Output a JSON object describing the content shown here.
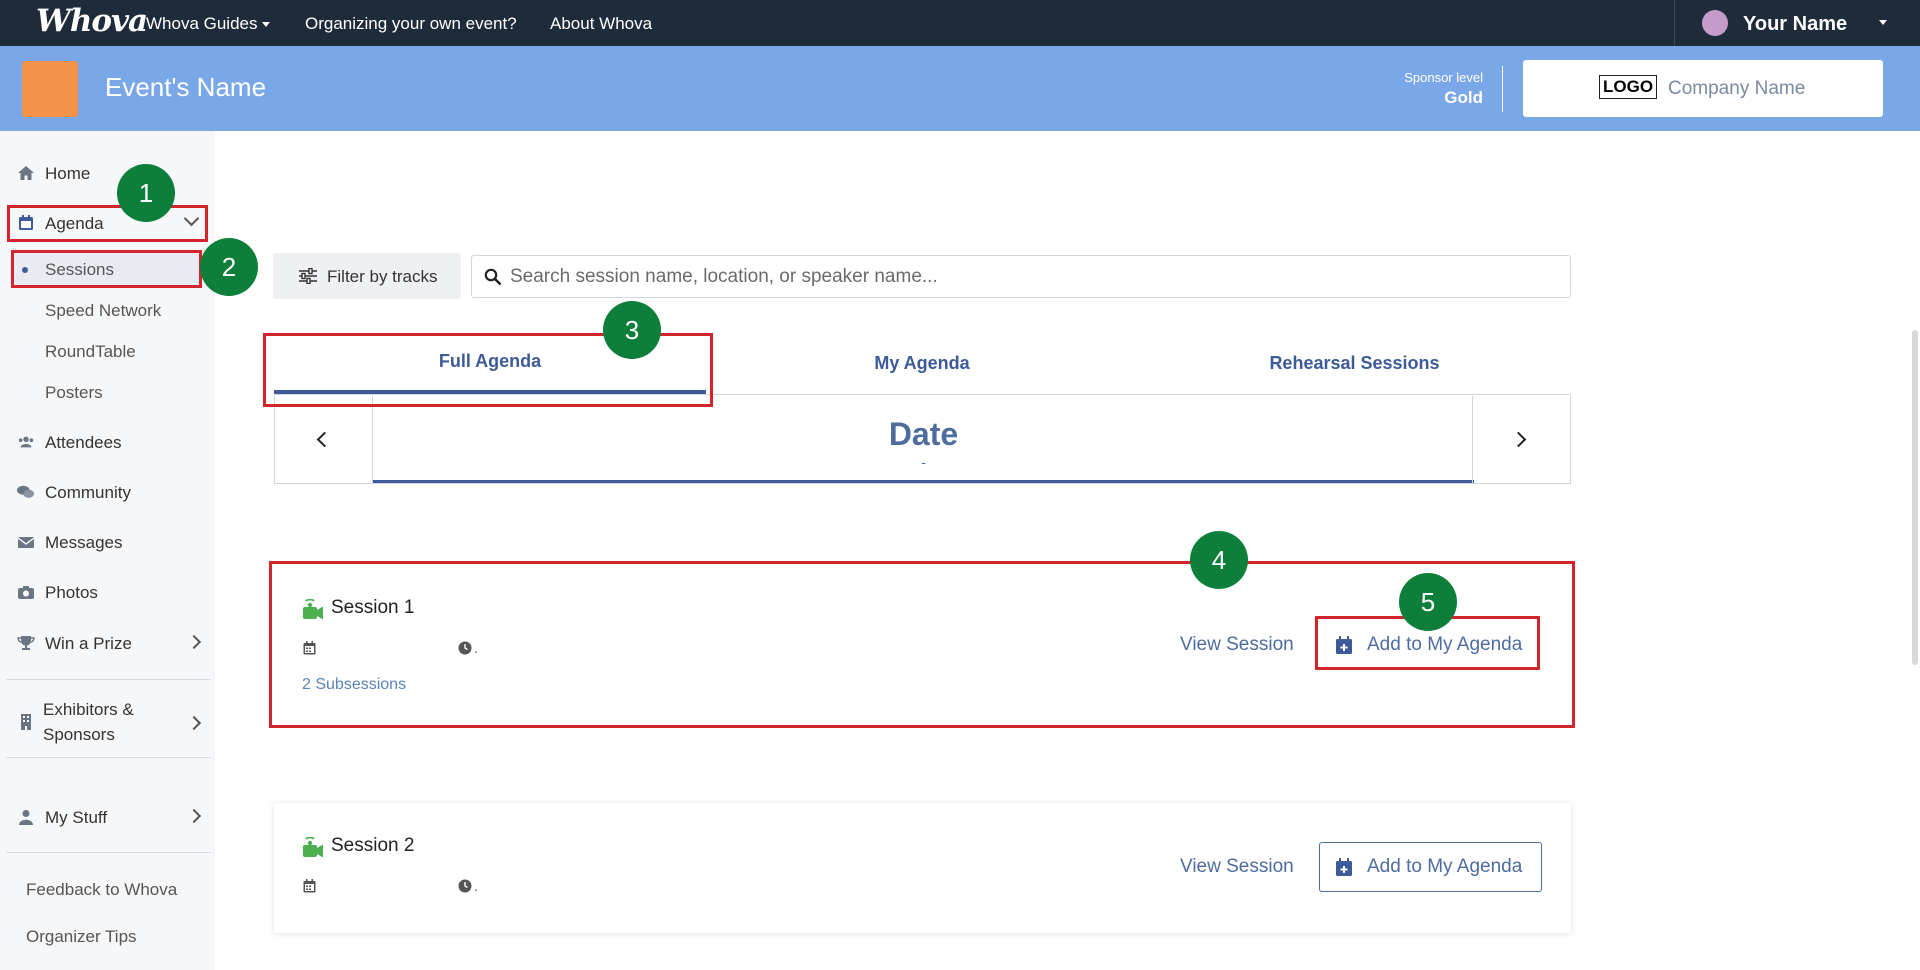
{
  "topnav": {
    "brand": "Whova",
    "links": [
      "Whova Guides",
      "Organizing your own event?",
      "About Whova"
    ],
    "user_name": "Your Name"
  },
  "event": {
    "name": "Event's Name",
    "sponsor_label": "Sponsor level",
    "sponsor_value": "Gold",
    "company_logo": "LOGO",
    "company_name": "Company Name"
  },
  "sidebar": {
    "home": "Home",
    "agenda": "Agenda",
    "agenda_sub": [
      "Sessions",
      "Speed Network",
      "RoundTable",
      "Posters"
    ],
    "attendees": "Attendees",
    "community": "Community",
    "messages": "Messages",
    "photos": "Photos",
    "win_prize": "Win a Prize",
    "exhibitors_line1": "Exhibitors &",
    "exhibitors_line2": "Sponsors",
    "my_stuff": "My Stuff",
    "feedback": "Feedback to Whova",
    "organizer_tips": "Organizer Tips"
  },
  "markers": [
    "1",
    "2",
    "3",
    "4",
    "5"
  ],
  "toolbar": {
    "filter_label": "Filter by tracks",
    "search_placeholder": "Search session name, location, or speaker name..."
  },
  "tabs": {
    "full": "Full Agenda",
    "mine": "My Agenda",
    "rehearsal": "Rehearsal Sessions"
  },
  "datenav": {
    "label": "Date",
    "sub": "-"
  },
  "sessions": [
    {
      "title": "Session 1",
      "time_suffix": ".",
      "subsessions": "2 Subsessions",
      "view": "View Session",
      "add": "Add to My Agenda"
    },
    {
      "title": "Session 2",
      "time_suffix": ".",
      "view": "View Session",
      "add": "Add to My Agenda"
    }
  ],
  "colors": {
    "topnav": "#1e2b3b",
    "eventbar": "#7aa7e8",
    "accent": "#3d5b99",
    "annotation_red": "#d4252d",
    "marker_green": "#0d7f3a",
    "camera_green": "#4caf50"
  }
}
